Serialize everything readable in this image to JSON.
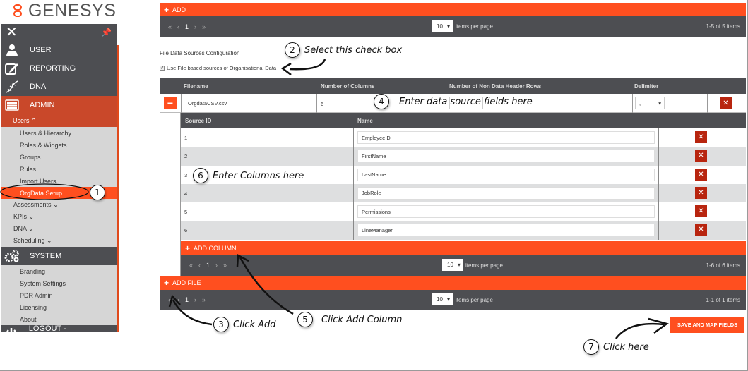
{
  "brand": {
    "logo_text": "GENESYS",
    "accent": "#ff4f1f",
    "sidebar_bg": "#4d4e52",
    "active_bg": "#c9482a"
  },
  "sidebar": {
    "close_icon": "close-icon",
    "pin_icon": "pin-icon",
    "main_items": [
      {
        "label": "USER",
        "icon": "user-icon"
      },
      {
        "label": "REPORTING",
        "icon": "edit-icon"
      },
      {
        "label": "DNA",
        "icon": "dna-icon"
      },
      {
        "label": "ADMIN",
        "icon": "list-icon",
        "active": true
      }
    ],
    "admin_sub_head": "Users ⌃",
    "admin_items": [
      "Users & Hierarchy",
      "Roles & Widgets",
      "Groups",
      "Rules",
      "Import Users",
      "OrgData Setup"
    ],
    "admin_selected": "OrgData Setup",
    "admin_groups": [
      "Assessments ⌄",
      "KPIs ⌄",
      "DNA ⌄",
      "Scheduling ⌄"
    ],
    "system_label": "SYSTEM",
    "system_items": [
      "Branding",
      "System Settings",
      "PDR Admin",
      "Licensing",
      "About"
    ],
    "logout_label": "LOGOUT - TADMIN@DEM"
  },
  "top_grid": {
    "add_label": "ADD",
    "pager": {
      "first": "«",
      "prev": "‹",
      "page": "1",
      "next": "›",
      "last": "»",
      "per_page": "10",
      "per_page_label": "items per page",
      "count": "1-5 of 5 items"
    }
  },
  "config": {
    "section_title": "File Data Sources Configuration",
    "checkbox_label": "Use File based sources of Organisational Data",
    "checkbox_checked": true
  },
  "file_table": {
    "headers": [
      "Filename",
      "Number of Columns",
      "Number of Non Data Header Rows",
      "Delimiter"
    ],
    "row": {
      "filename": "OrgdataCSV.csv",
      "num_columns": "6",
      "header_rows": "",
      "delimiter": ","
    }
  },
  "column_table": {
    "headers": [
      "Source ID",
      "Name"
    ],
    "rows": [
      {
        "id": "1",
        "name": "EmployeeID"
      },
      {
        "id": "2",
        "name": "FirstName"
      },
      {
        "id": "3",
        "name": "LastName"
      },
      {
        "id": "4",
        "name": "JobRole"
      },
      {
        "id": "5",
        "name": "Permissions"
      },
      {
        "id": "6",
        "name": "LineManager"
      }
    ],
    "add_label": "ADD COLUMN",
    "pager": {
      "first": "«",
      "prev": "‹",
      "page": "1",
      "next": "›",
      "last": "»",
      "per_page": "10",
      "per_page_label": "items per page",
      "count": "1-6 of 6 items"
    }
  },
  "file_grid": {
    "add_label": "ADD FILE",
    "pager": {
      "first": "«",
      "prev": "‹",
      "page": "1",
      "next": "›",
      "last": "»",
      "per_page": "10",
      "per_page_label": "items per page",
      "count": "1-1 of 1 items"
    }
  },
  "save_label": "SAVE AND MAP FIELDS",
  "annotations": [
    {
      "num": "1",
      "text": ""
    },
    {
      "num": "2",
      "text": "Select this check box"
    },
    {
      "num": "3",
      "text": "Click Add"
    },
    {
      "num": "4",
      "text": "Enter data source fields here"
    },
    {
      "num": "5",
      "text": "Click Add Column"
    },
    {
      "num": "6",
      "text": "Enter Columns here"
    },
    {
      "num": "7",
      "text": "Click here"
    }
  ]
}
